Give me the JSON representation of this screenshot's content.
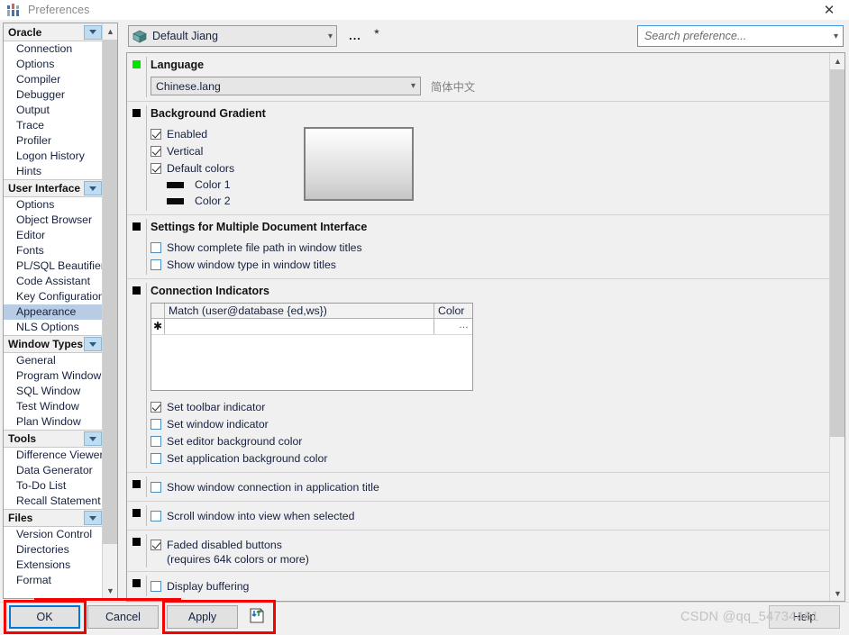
{
  "window": {
    "title": "Preferences",
    "icon": "sliders-icon",
    "close_label": "✕"
  },
  "sidebar": {
    "groups": [
      {
        "label": "Oracle",
        "items": [
          "Connection",
          "Options",
          "Compiler",
          "Debugger",
          "Output",
          "Trace",
          "Profiler",
          "Logon History",
          "Hints"
        ]
      },
      {
        "label": "User Interface",
        "items": [
          "Options",
          "Object Browser",
          "Editor",
          "Fonts",
          "PL/SQL Beautifier",
          "Code Assistant",
          "Key Configuration",
          "Appearance",
          "NLS Options"
        ],
        "selected": "Appearance"
      },
      {
        "label": "Window Types",
        "items": [
          "General",
          "Program Window",
          "SQL Window",
          "Test Window",
          "Plan Window"
        ]
      },
      {
        "label": "Tools",
        "items": [
          "Difference Viewer",
          "Data Generator",
          "To-Do List",
          "Recall Statement"
        ]
      },
      {
        "label": "Files",
        "items": [
          "Version Control",
          "Directories",
          "Extensions",
          "Format"
        ]
      }
    ]
  },
  "toolbar": {
    "profile_value": "Default Jiang",
    "profile_icon": "package-icon",
    "dots_label": "...",
    "star_label": "*",
    "search_placeholder": "Search preference...",
    "search_value": ""
  },
  "sections": {
    "language": {
      "marker_color": "#00e400",
      "title": "Language",
      "select_value": "Chinese.lang",
      "note": "简体中文"
    },
    "background_gradient": {
      "title": "Background Gradient",
      "checkboxes": [
        {
          "label": "Enabled",
          "checked": true
        },
        {
          "label": "Vertical",
          "checked": true
        },
        {
          "label": "Default colors",
          "checked": true
        }
      ],
      "swatches": [
        {
          "label": "Color 1",
          "color": "#0a0a0a"
        },
        {
          "label": "Color 2",
          "color": "#0a0a0a"
        }
      ]
    },
    "mdi": {
      "title": "Settings for Multiple Document Interface",
      "checkboxes": [
        {
          "label": "Show complete file path in window titles",
          "checked": false
        },
        {
          "label": "Show window type in window titles",
          "checked": false
        }
      ]
    },
    "connection_indicators": {
      "title": "Connection Indicators",
      "grid": {
        "columns": [
          "",
          "Match (user@database {ed,ws})",
          "Color"
        ],
        "rows": [
          {
            "marker": "✱",
            "match": "",
            "color": "…"
          }
        ]
      },
      "checkboxes": [
        {
          "label": "Set toolbar indicator",
          "checked": true
        },
        {
          "label": "Set window indicator",
          "checked": false
        },
        {
          "label": "Set editor background color",
          "checked": false
        },
        {
          "label": "Set application background color",
          "checked": false
        }
      ]
    },
    "show_window_connection": {
      "label": "Show window connection in application title",
      "checked": false
    },
    "scroll_window": {
      "label": "Scroll window into view when selected",
      "checked": false
    },
    "faded_buttons": {
      "label": "Faded disabled buttons",
      "sub_label": "(requires 64k colors or more)",
      "checked": true
    },
    "display_buffering": {
      "label": "Display buffering",
      "checked": false
    }
  },
  "footer": {
    "ok_label": "OK",
    "cancel_label": "Cancel",
    "apply_label": "Apply",
    "help_label": "Help",
    "apply_icon": "save-to-file-icon",
    "watermark": "CSDN @qq_54734461",
    "highlight_color": "#f60000"
  }
}
